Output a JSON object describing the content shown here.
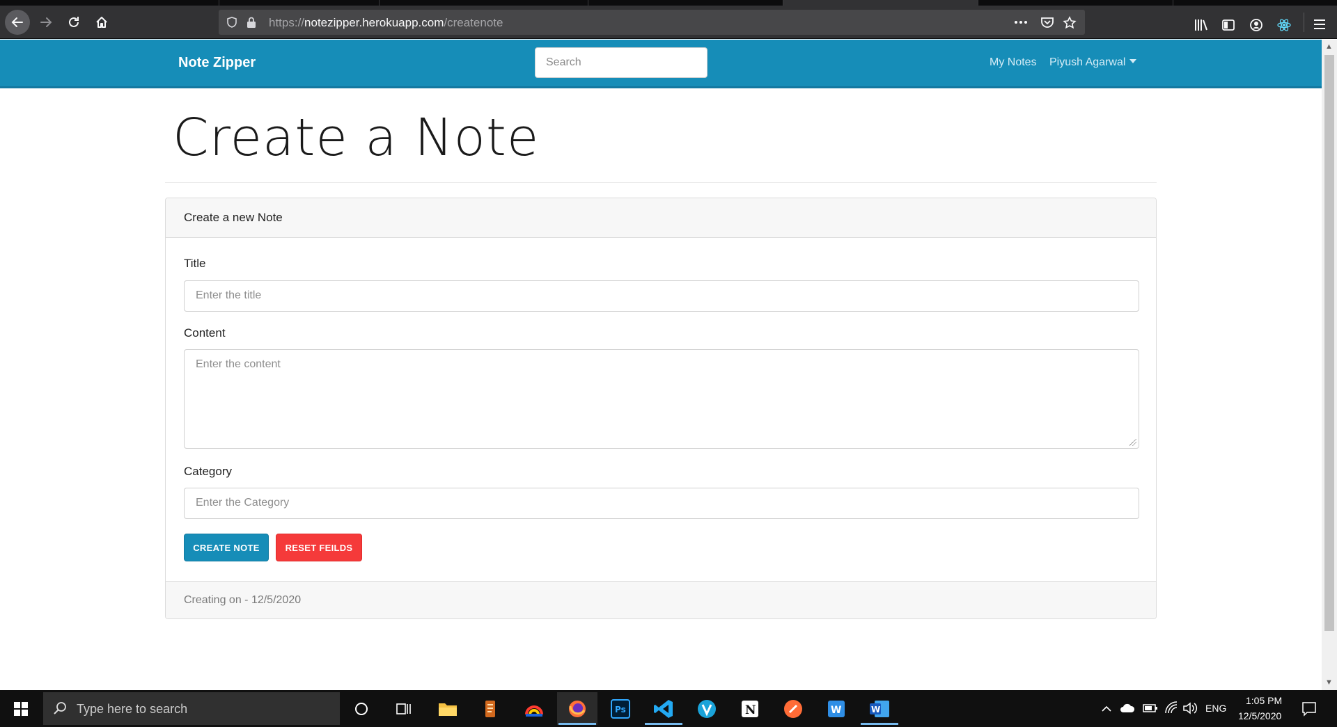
{
  "browser": {
    "url_prefix": "https://",
    "url_host": "notezipper.herokuapp.com",
    "url_path": "/createnote"
  },
  "navbar": {
    "brand": "Note Zipper",
    "search_placeholder": "Search",
    "my_notes": "My Notes",
    "user_name": "Piyush Agarwal"
  },
  "page": {
    "title": "Create a Note"
  },
  "card": {
    "header": "Create a new Note",
    "title_label": "Title",
    "title_placeholder": "Enter the title",
    "content_label": "Content",
    "content_placeholder": "Enter the content",
    "category_label": "Category",
    "category_placeholder": "Enter the Category",
    "create_button": "CREATE NOTE",
    "reset_button": "RESET FEILDS",
    "footer": "Creating on - 12/5/2020"
  },
  "taskbar": {
    "search_placeholder": "Type here to search",
    "language": "ENG",
    "time": "1:05 PM",
    "date": "12/5/2020"
  },
  "colors": {
    "navbar": "#168db8",
    "primary_button": "#168db8",
    "danger_button": "#f53a3a"
  }
}
